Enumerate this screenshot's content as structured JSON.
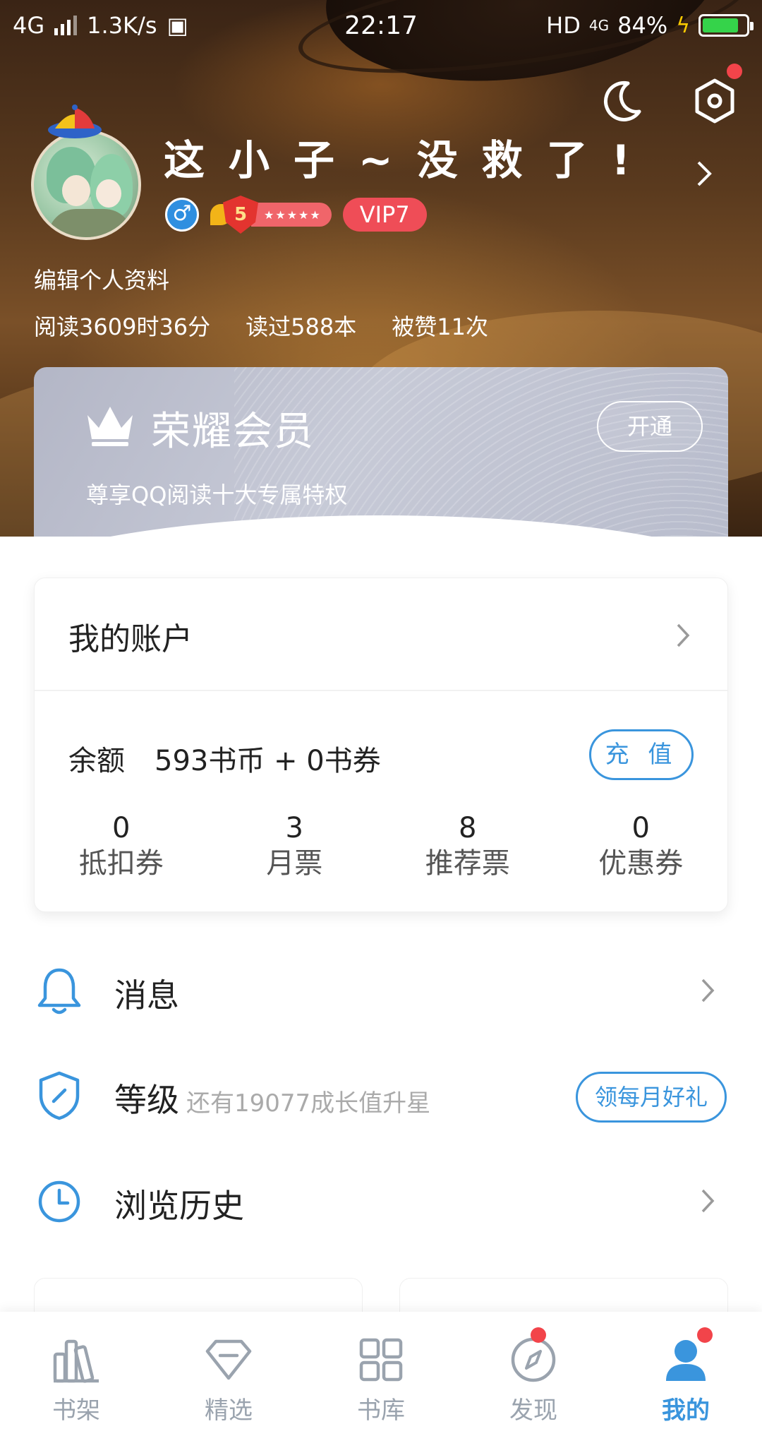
{
  "status_bar": {
    "network": "4G",
    "speed": "1.3K/s",
    "time": "22:17",
    "hd": "HD",
    "network_right": "4G",
    "battery": "84%",
    "battery_level": 0.84
  },
  "profile": {
    "nickname": "这小子~没救了!",
    "level": "5",
    "level_stars": "★★★★★",
    "vip": "VIP7",
    "edit_link": "编辑个人资料",
    "stats": {
      "reading_time": "阅读3609时36分",
      "books_read": "读过588本",
      "likes": "被赞11次"
    }
  },
  "vip_card": {
    "title": "荣耀会员",
    "subtitle": "尊享QQ阅读十大专属特权",
    "button": "开通"
  },
  "account": {
    "title": "我的账户",
    "balance_label": "余额",
    "balance_value": "593书币 + 0书券",
    "recharge_button": "充 值",
    "tickets": [
      {
        "value": "0",
        "label": "抵扣券"
      },
      {
        "value": "3",
        "label": "月票"
      },
      {
        "value": "8",
        "label": "推荐票"
      },
      {
        "value": "0",
        "label": "优惠券"
      }
    ]
  },
  "menu": {
    "messages": "消息",
    "level": "等级",
    "level_sub": "还有19077成长值升星",
    "gift_button": "领每月好礼",
    "history": "浏览历史"
  },
  "bottom_nav": {
    "tabs": [
      {
        "label": "书架",
        "icon": "bookshelf-icon"
      },
      {
        "label": "精选",
        "icon": "diamond-icon"
      },
      {
        "label": "书库",
        "icon": "grid-icon"
      },
      {
        "label": "发现",
        "icon": "compass-icon"
      },
      {
        "label": "我的",
        "icon": "user-icon"
      }
    ],
    "active": "我的"
  },
  "colors": {
    "accent": "#3a95dd",
    "badge_red": "#f2444a",
    "vip_red": "#ef4d57"
  }
}
